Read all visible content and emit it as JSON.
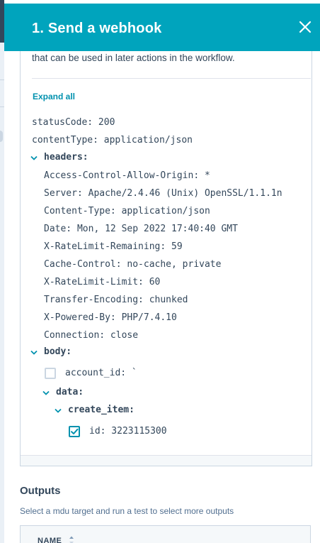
{
  "panel": {
    "title": "1. Send a webhook",
    "description_tail": "that can be used in later actions in the workflow.",
    "expand_all": "Expand all"
  },
  "response": {
    "status_code": "statusCode: 200",
    "content_type": "contentType: application/json",
    "headers_label": "headers:",
    "headers": [
      "Access-Control-Allow-Origin: *",
      "Server: Apache/2.4.46 (Unix) OpenSSL/1.1.1n",
      "Content-Type: application/json",
      "Date: Mon, 12 Sep 2022 17:40:40 GMT",
      "X-RateLimit-Remaining: 59",
      "Cache-Control: no-cache, private",
      "X-RateLimit-Limit: 60",
      "Transfer-Encoding: chunked",
      "X-Powered-By: PHP/7.4.10",
      "Connection: close"
    ],
    "body_label": "body:",
    "account_id": "account_id: `",
    "data_label": "data:",
    "create_item_label": "create_item:",
    "id_field": "id: 3223115300"
  },
  "outputs": {
    "title": "Outputs",
    "hint": "Select a mdu target and run a test to select more outputs",
    "column_name": "NAME"
  },
  "colors": {
    "header": "#00a4bd",
    "accent": "#0091ae",
    "text": "#33475b"
  }
}
